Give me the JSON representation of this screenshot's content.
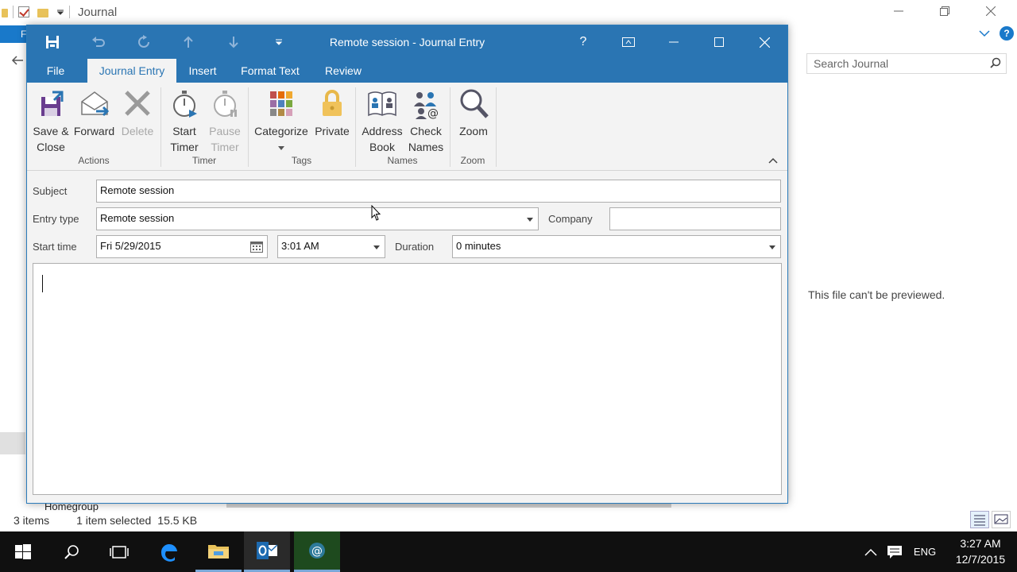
{
  "explorer": {
    "title": "Journal",
    "file_tab": "F",
    "search_placeholder": "Search Journal",
    "preview_message": "This file can't be previewed.",
    "nav_item": "Homegroup",
    "status": {
      "items": "3 items",
      "selected": "1 item selected",
      "size": "15.5 KB"
    }
  },
  "journal": {
    "window_title": "Remote session - Journal Entry",
    "help_label": "?",
    "tabs": [
      {
        "label": "File"
      },
      {
        "label": "Journal Entry"
      },
      {
        "label": "Insert"
      },
      {
        "label": "Format Text"
      },
      {
        "label": "Review"
      }
    ],
    "ribbon": {
      "save_close": "Save & Close",
      "save_close_l1": "Save &",
      "save_close_l2": "Close",
      "forward": "Forward",
      "delete": "Delete",
      "start_timer_l1": "Start",
      "start_timer_l2": "Timer",
      "pause_timer_l1": "Pause",
      "pause_timer_l2": "Timer",
      "categorize": "Categorize",
      "private": "Private",
      "address_book_l1": "Address",
      "address_book_l2": "Book",
      "check_names_l1": "Check",
      "check_names_l2": "Names",
      "zoom": "Zoom",
      "groups": {
        "actions": "Actions",
        "timer": "Timer",
        "tags": "Tags",
        "names": "Names",
        "zoom": "Zoom"
      }
    },
    "form": {
      "subject_label": "Subject",
      "subject_value": "Remote session",
      "entry_type_label": "Entry type",
      "entry_type_value": "Remote session",
      "company_label": "Company",
      "company_value": "",
      "start_time_label": "Start time",
      "start_date_value": "Fri 5/29/2015",
      "start_time_value": "3:01 AM",
      "duration_label": "Duration",
      "duration_value": "0 minutes",
      "body_text": ""
    }
  },
  "taskbar": {
    "language": "ENG",
    "time": "3:27 AM",
    "date": "12/7/2015"
  },
  "colors": {
    "outlook_blue": "#2a75b3",
    "explorer_blue": "#1979ca",
    "taskbar": "#101010"
  }
}
